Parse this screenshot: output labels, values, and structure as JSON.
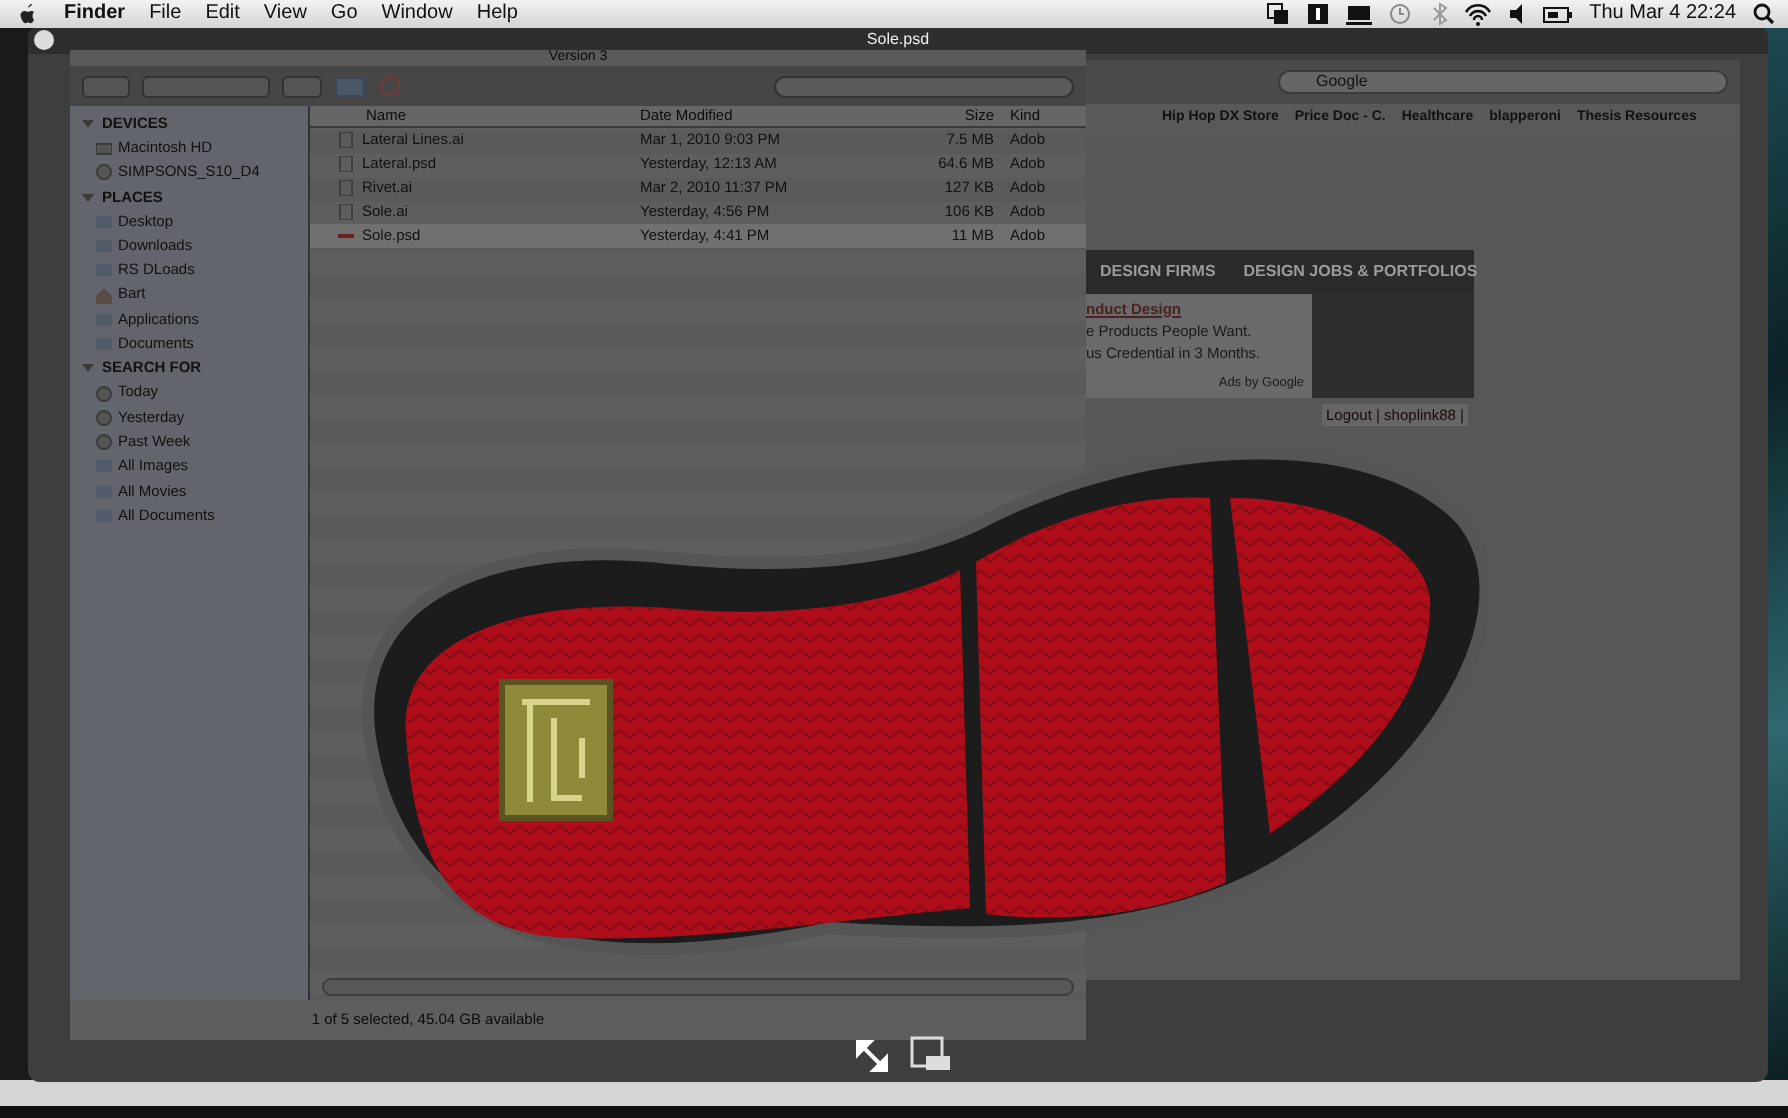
{
  "menu_bar": {
    "app_name": "Finder",
    "menus": [
      "File",
      "Edit",
      "View",
      "Go",
      "Window",
      "Help"
    ],
    "clock": "Thu Mar 4  22:24"
  },
  "finder": {
    "title": "Version 3",
    "columns": [
      "Name",
      "Date Modified",
      "Size",
      "Kind"
    ],
    "sidebar": [
      {
        "heading": "DEVICES",
        "items": [
          {
            "label": "Macintosh HD",
            "kind": "drive"
          },
          {
            "label": "SIMPSONS_S10_D4",
            "kind": "disc"
          }
        ]
      },
      {
        "heading": "PLACES",
        "items": [
          {
            "label": "Desktop",
            "kind": "folder"
          },
          {
            "label": "Downloads",
            "kind": "folder"
          },
          {
            "label": "RS DLoads",
            "kind": "folder"
          },
          {
            "label": "Bart",
            "kind": "home"
          },
          {
            "label": "Applications",
            "kind": "folder"
          },
          {
            "label": "Documents",
            "kind": "folder"
          }
        ]
      },
      {
        "heading": "SEARCH FOR",
        "items": [
          {
            "label": "Today",
            "kind": "clock"
          },
          {
            "label": "Yesterday",
            "kind": "clock"
          },
          {
            "label": "Past Week",
            "kind": "clock"
          },
          {
            "label": "All Images",
            "kind": "folder"
          },
          {
            "label": "All Movies",
            "kind": "folder"
          },
          {
            "label": "All Documents",
            "kind": "folder"
          }
        ]
      }
    ],
    "rows": [
      {
        "name": "Lateral Lines.ai",
        "date": "Mar 1, 2010 9:03 PM",
        "size": "7.5 MB",
        "kind": "Adob",
        "selected": false
      },
      {
        "name": "Lateral.psd",
        "date": "Yesterday, 12:13 AM",
        "size": "64.6 MB",
        "kind": "Adob",
        "selected": false
      },
      {
        "name": "Rivet.ai",
        "date": "Mar 2, 2010 11:37 PM",
        "size": "127 KB",
        "kind": "Adob",
        "selected": false
      },
      {
        "name": "Sole.ai",
        "date": "Yesterday, 4:56 PM",
        "size": "106 KB",
        "kind": "Adob",
        "selected": false
      },
      {
        "name": "Sole.psd",
        "date": "Yesterday, 4:41 PM",
        "size": "11 MB",
        "kind": "Adob",
        "selected": true
      }
    ],
    "status": "1 of 5 selected, 45.04 GB available"
  },
  "browser": {
    "search": {
      "placeholder": "Google"
    },
    "bookmarks": [
      "Hip Hop DX Store",
      "Price Doc - C.",
      "Healthcare",
      "blapperoni",
      "Thesis Resources"
    ],
    "nav": [
      "DESIGN FIRMS",
      "DESIGN JOBS & PORTFOLIOS"
    ],
    "ad_title": "nduct Design",
    "ad_lines": [
      "e Products People Want.",
      "us Credential in 3 Months."
    ],
    "ad_credit": "Ads by Google",
    "login": "Logout | shoplink88 |"
  },
  "quick_look": {
    "title": "Sole.psd"
  }
}
